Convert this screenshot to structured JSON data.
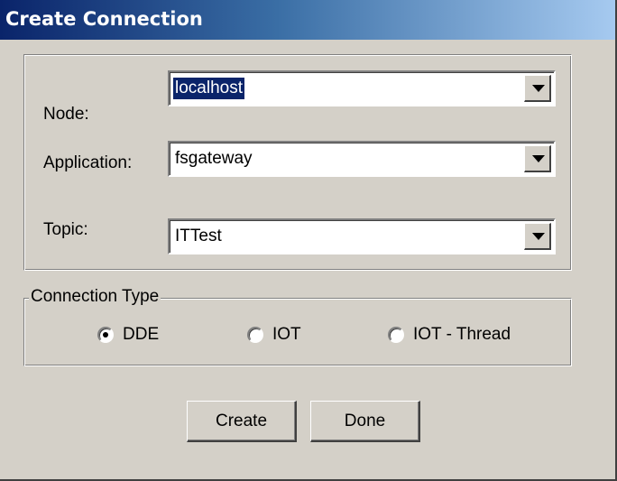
{
  "window": {
    "title": "Create Connection"
  },
  "fields": {
    "node": {
      "label": "Node:",
      "value": "localhost"
    },
    "application": {
      "label": "Application:",
      "value": "fsgateway"
    },
    "topic": {
      "label": "Topic:",
      "value": "ITTest"
    }
  },
  "connection_type": {
    "legend": "Connection Type",
    "options": [
      {
        "label": "DDE",
        "selected": true
      },
      {
        "label": "IOT",
        "selected": false
      },
      {
        "label": "IOT - Thread",
        "selected": false
      }
    ]
  },
  "buttons": {
    "create": "Create",
    "done": "Done"
  },
  "colors": {
    "titlebar_start": "#0a246a",
    "titlebar_end": "#a6caf0",
    "face": "#d4d0c8",
    "selection": "#0a246a"
  }
}
